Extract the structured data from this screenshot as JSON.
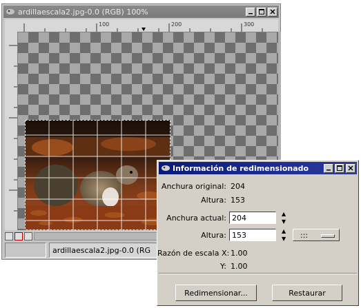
{
  "image_window": {
    "title": "ardillaescala2.jpg-0.0 (RGB) 100%",
    "ruler_ticks": [
      "100",
      "200",
      "300"
    ],
    "status_text": "ardillaescala2.jpg-0.0 (RG"
  },
  "resize_dialog": {
    "title": "Información de redimensionado",
    "original_width_label": "Anchura original:",
    "original_width_value": "204",
    "height_label_static": "Altura:",
    "height_value_static": "153",
    "current_width_label": "Anchura actual:",
    "current_width_value": "204",
    "current_height_label": "Altura:",
    "current_height_value": "153",
    "unit_select_value": ":::",
    "scale_x_label": "Razón de escala X:",
    "scale_x_value": "1.00",
    "scale_y_label": "Y:",
    "scale_y_value": "1.00",
    "resize_button": "Redimensionar...",
    "reset_button": "Restaurar"
  },
  "colors": {
    "dialog_title_bg": "#0a1a7a",
    "window_bg": "#c6c6c6",
    "dialog_bg": "#d4d0c8"
  },
  "icons": [
    "window-icon",
    "minimize-icon",
    "maximize-icon",
    "close-icon",
    "spin-up-icon",
    "spin-down-icon"
  ]
}
